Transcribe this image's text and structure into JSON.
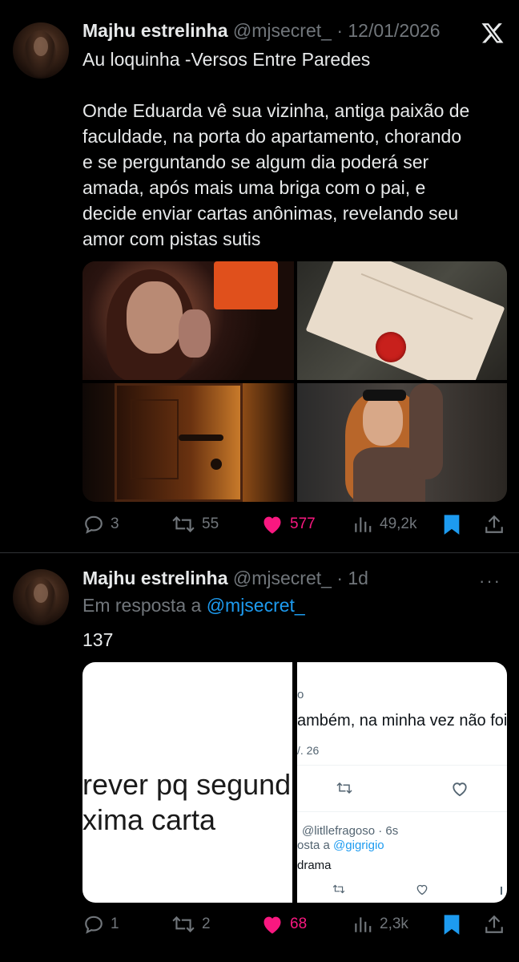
{
  "tweets": [
    {
      "author_name": "Majhu estrelinha",
      "handle": "@mjsecret_",
      "separator": "·",
      "time": "12/01/2026",
      "text_lines": [
        "Au loquinha -Versos Entre Paredes",
        "",
        "Onde Eduarda vê sua vizinha, antiga paixão de",
        "faculdade, na porta do apartamento, chorando",
        "e se perguntando se algum dia poderá ser",
        "amada, após mais uma briga com o pai, e",
        "decide enviar cartas anônimas, revelando seu",
        "amor com pistas sutis"
      ],
      "stats": {
        "replies": "3",
        "retweets": "55",
        "likes": "577",
        "views": "49,2k"
      },
      "liked": true
    },
    {
      "author_name": "Majhu estrelinha",
      "handle": "@mjsecret_",
      "separator": "·",
      "time": "1d",
      "reply_prefix": "Em resposta a",
      "reply_handle": "@mjsecret_",
      "text": "137",
      "screenshot_left": {
        "line1": "rever pq segund",
        "line2": "xima carta"
      },
      "screenshot_right": {
        "top_fragment": "o",
        "reply_text": "ambém, na minha vez não foi",
        "date_fragment": "/. 26",
        "second_author": "@litllefragoso · 6s",
        "second_reply_prefix": "osta a",
        "second_reply_handle": "@gigrigio",
        "second_text": "drama"
      },
      "stats": {
        "replies": "1",
        "retweets": "2",
        "likes": "68",
        "views": "2,3k"
      },
      "liked": true
    }
  ],
  "colors": {
    "background": "#000000",
    "text": "#e7e9ea",
    "muted": "#71767b",
    "link": "#1d9bf0",
    "like": "#f91880",
    "bookmark": "#1d9bf0"
  },
  "icons": {
    "platform": "x-logo-icon",
    "reply": "reply-bubble-icon",
    "retweet": "retweet-icon",
    "like": "heart-icon",
    "views": "views-bars-icon",
    "bookmark": "bookmark-icon",
    "share": "share-icon",
    "more": "more-dots-icon"
  }
}
